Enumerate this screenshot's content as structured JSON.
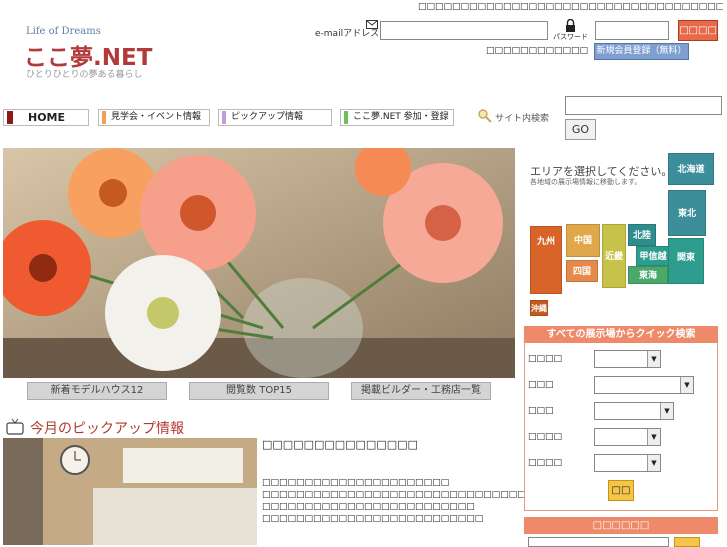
{
  "header": {
    "top_text": "□□□□□□□□□□□□□□□□□□□□□□□□□□□□□□□□□□□□□□□□□□□□□□□□□□□□□□",
    "logo_tagline": "Life of Dreams",
    "logo_main": "ここ夢.NET",
    "logo_sub": "ひとりひとりの夢ある暮らし",
    "email_label": "e-mailアドレス",
    "password_label": "パスワード",
    "login_button": "□□□□",
    "forgot_text": "□□□□□□□□□□□□",
    "register_button": "新規会員登録（無料）"
  },
  "nav": {
    "home": "HOME",
    "event": "見学会・イベント情報",
    "pickup": "ピックアップ情報",
    "join": "ここ夢.NET 参加・登録",
    "search_label": "サイト内検索",
    "search_value": "",
    "go_button": "GO"
  },
  "colors": {
    "home_bar": "#8b1a1a",
    "event_bar": "#f0a050",
    "pickup_bar": "#c59ad8",
    "join_bar": "#6cbf5a"
  },
  "sub_buttons": {
    "model": "新着モデルハウス12",
    "top": "閲覧数 TOP15",
    "builder": "掲載ビルダー・工務店一覧"
  },
  "pickup": {
    "title": "今月のピックアップ情報",
    "headline": "□□□□□□□□□□□□□□□",
    "lines": [
      "□□□□□□□□□□□□□□□□□□□□□□",
      "□□□□□□□□□□□□□□□□□□□□□□□□□□□□□□□□□□□□□□□□□□□",
      "□□□□□□□□□□□□□□□□□□□□□□□□□",
      "□□□□□□□□□□□□□□□□□□□□□□□□□□"
    ]
  },
  "area": {
    "title": "エリアを選択してください。",
    "sub": "各地域の展示場情報に移動します。",
    "regions": {
      "hokkaido": "北海道",
      "tohoku": "東北",
      "hokuriku": "北陸",
      "koshinetsu": "甲信越",
      "kanto": "関東",
      "tokai": "東海",
      "kinki": "近畿",
      "chugoku": "中国",
      "shikoku": "四国",
      "kyushu": "九州",
      "okinawa": "沖縄"
    }
  },
  "quick_search": {
    "header": "すべての展示場からクイック検索",
    "labels": [
      "□□□□",
      "□□□",
      "□□□",
      "□□□□",
      "□□□□"
    ],
    "submit": "□□"
  },
  "keyword": {
    "header": "□□□□□□"
  }
}
